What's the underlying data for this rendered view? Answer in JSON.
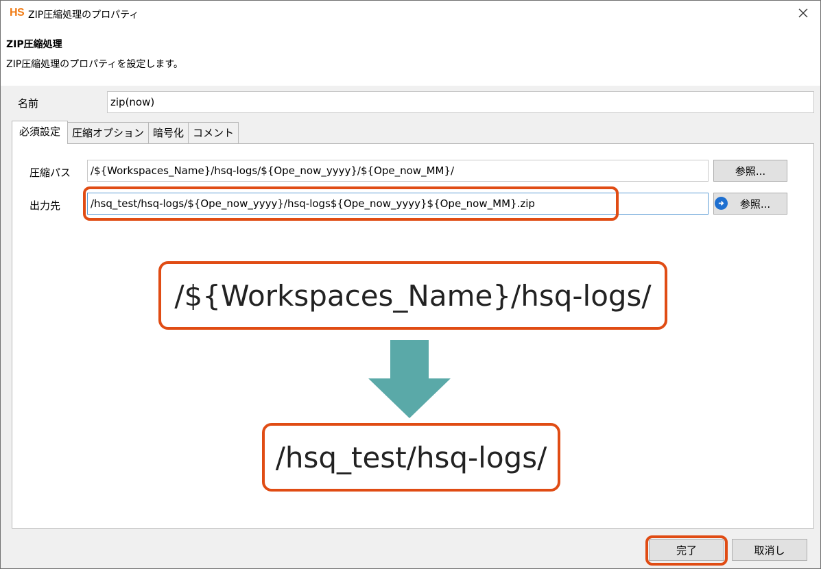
{
  "window": {
    "logo": "HS",
    "title": "ZIP圧縮処理のプロパティ"
  },
  "header": {
    "title": "ZIP圧縮処理",
    "description": "ZIP圧縮処理のプロパティを設定します。"
  },
  "name_field": {
    "label": "名前",
    "value": "zip(now)"
  },
  "tabs": [
    {
      "label": "必須設定",
      "active": true
    },
    {
      "label": "圧縮オプション",
      "active": false
    },
    {
      "label": "暗号化",
      "active": false
    },
    {
      "label": "コメント",
      "active": false
    }
  ],
  "compress_path": {
    "label": "圧縮パス",
    "value": "/${Workspaces_Name}/hsq-logs/${Ope_now_yyyy}/${Ope_now_MM}/",
    "browse_label": "参照..."
  },
  "output_path": {
    "label": "出力先",
    "value": "/hsq_test/hsq-logs/${Ope_now_yyyy}/hsq-logs${Ope_now_yyyy}${Ope_now_MM}.zip",
    "browse_label": "参照..."
  },
  "callout": {
    "before": "/${Workspaces_Name}/hsq-logs/",
    "after": "/hsq_test/hsq-logs/"
  },
  "footer": {
    "ok_label": "完了",
    "cancel_label": "取消し"
  },
  "colors": {
    "highlight": "#e04c14",
    "arrow": "#5aa9a8",
    "logo": "#f07a12",
    "browse_arrow": "#1e6fd0"
  },
  "icons": {
    "close": "close-icon",
    "browse_arrow": "arrow-right-circle-icon",
    "down_arrow": "arrow-down-icon"
  }
}
